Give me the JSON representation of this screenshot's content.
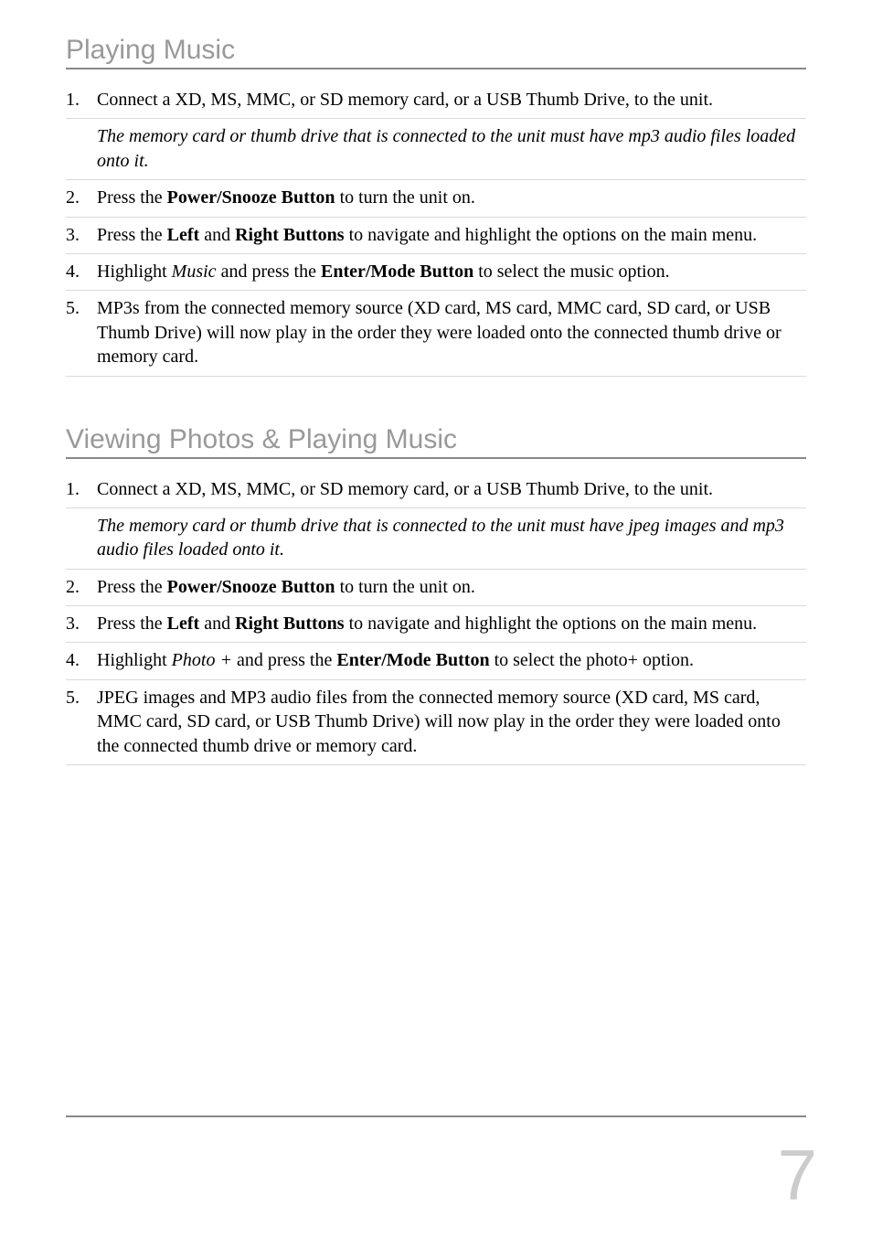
{
  "sections": {
    "playing_music": {
      "heading": "Playing Music",
      "items": {
        "s1": "Connect a XD, MS, MMC, or SD memory card, or a USB Thumb Drive, to the unit.",
        "note": "The memory card or thumb drive that is connected to the unit must have mp3 audio files loaded onto it.",
        "s2a": "Press the ",
        "s2b": "Power/Snooze Button",
        "s2c": " to turn the unit on.",
        "s3a": "Press the ",
        "s3b": "Left",
        "s3c": " and ",
        "s3d": "Right Buttons",
        "s3e": " to navigate and highlight the options on the main menu.",
        "s4a": "Highlight ",
        "s4b": "Music",
        "s4c": " and press the ",
        "s4d": "Enter/Mode Button",
        "s4e": " to select the music option.",
        "s5": "MP3s from the connected memory source (XD card, MS card, MMC card, SD card, or USB Thumb Drive) will now play in the order they were loaded onto the connected thumb drive or memory card."
      }
    },
    "viewing_photos": {
      "heading": "Viewing Photos & Playing Music",
      "items": {
        "s1": "Connect a XD, MS, MMC, or SD memory card, or a USB Thumb Drive, to the unit.",
        "note": "The memory card or thumb drive that is connected to the unit must have jpeg images and mp3 audio files loaded onto it.",
        "s2a": "Press the ",
        "s2b": "Power/Snooze Button",
        "s2c": " to turn the unit on.",
        "s3a": "Press the ",
        "s3b": "Left",
        "s3c": " and ",
        "s3d": "Right Buttons",
        "s3e": " to navigate and highlight the options on the main menu.",
        "s4a": "Highlight ",
        "s4b": "Photo +",
        "s4c": " and press the ",
        "s4d": "Enter/Mode Button",
        "s4e": " to select the photo+ option.",
        "s5": "JPEG images and MP3 audio files from the connected memory source (XD card, MS card, MMC card, SD card, or USB Thumb Drive) will now play in the order they were loaded onto the connected thumb drive or memory card."
      }
    }
  },
  "page_number": "7"
}
